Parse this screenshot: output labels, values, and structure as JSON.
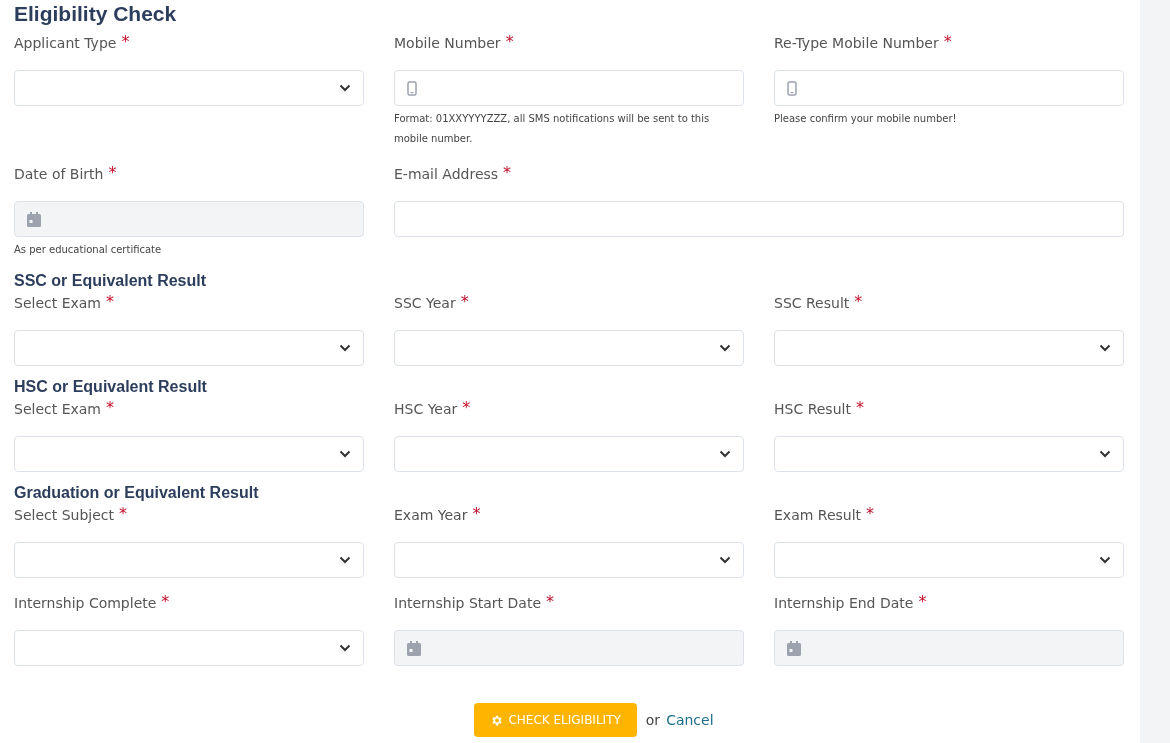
{
  "title": "Eligibility Check",
  "sections": [
    {
      "rows": [
        [
          {
            "kind": "select",
            "label": "Applicant Type",
            "mark": "*"
          },
          {
            "kind": "phone",
            "label": "Mobile Number",
            "mark": "*",
            "hint": "Format: 01XXYYYYZZZ, all SMS notifications will be sent to this mobile number."
          },
          {
            "kind": "phone",
            "label": "Re-Type Mobile Number",
            "mark": "*",
            "hint": "Please confirm your mobile number!"
          }
        ],
        [
          {
            "kind": "date",
            "label": "Date of Birth",
            "mark": "*",
            "disabled": true,
            "hint": "As per educational certificate"
          },
          {
            "kind": "text",
            "label": "E-mail Address",
            "mark": "*",
            "wide": true
          }
        ]
      ]
    },
    {
      "title": "SSC or Equivalent Result",
      "rows": [
        [
          {
            "kind": "select",
            "label": "Select Exam",
            "mark": "*"
          },
          {
            "kind": "select",
            "label": "SSC Year",
            "mark": "*"
          },
          {
            "kind": "select",
            "label": "SSC Result",
            "mark": "*"
          }
        ]
      ]
    },
    {
      "title": "HSC or Equivalent Result",
      "rows": [
        [
          {
            "kind": "select",
            "label": "Select Exam",
            "mark": "*"
          },
          {
            "kind": "select",
            "label": "HSC Year",
            "mark": "*"
          },
          {
            "kind": "select",
            "label": "HSC Result",
            "mark": "*"
          }
        ]
      ]
    },
    {
      "title": "Graduation or Equivalent Result",
      "rows": [
        [
          {
            "kind": "select",
            "label": "Select Subject",
            "mark": "*"
          },
          {
            "kind": "select",
            "label": "Exam Year",
            "mark": "*"
          },
          {
            "kind": "select",
            "label": "Exam Result",
            "mark": "*"
          }
        ],
        [
          {
            "kind": "select",
            "label": "Internship Complete",
            "mark": "*"
          },
          {
            "kind": "date",
            "label": "Internship Start Date",
            "mark": "*",
            "disabled": true
          },
          {
            "kind": "date",
            "label": "Internship End Date",
            "mark": "*",
            "disabled": true
          }
        ]
      ]
    }
  ],
  "actions": {
    "submit": "CHECK ELIGIBILITY",
    "or": "or",
    "cancel": "Cancel"
  }
}
